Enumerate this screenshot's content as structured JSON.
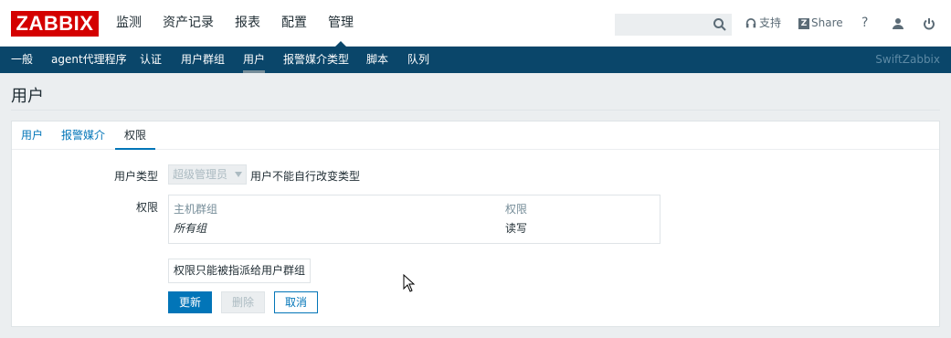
{
  "logo": "ZABBIX",
  "main_menu": [
    "监测",
    "资产记录",
    "报表",
    "配置",
    "管理"
  ],
  "main_menu_active": "管理",
  "search": {
    "placeholder": ""
  },
  "top_actions": {
    "support": "支持",
    "share": "Share",
    "help": "?"
  },
  "sub_menu": [
    "一般",
    "agent代理程序",
    "认证",
    "用户群组",
    "用户",
    "报警媒介类型",
    "脚本",
    "队列"
  ],
  "sub_menu_active": "用户",
  "brand": "SwiftZabbix",
  "page_title": "用户",
  "tabs": [
    "用户",
    "报警媒介",
    "权限"
  ],
  "tab_active": "权限",
  "form": {
    "user_type_label": "用户类型",
    "user_type_value": "超级管理员",
    "user_type_note": "用户不能自行改变类型",
    "permissions_label": "权限",
    "table_headers": [
      "主机群组",
      "权限"
    ],
    "table_rows": [
      {
        "group": "所有组",
        "permission": "读写"
      }
    ],
    "assign_note": "权限只能被指派给用户群组"
  },
  "buttons": {
    "update": "更新",
    "delete": "删除",
    "cancel": "取消"
  },
  "colors": {
    "brand_red": "#d40000",
    "nav_bg": "#0a466a",
    "accent": "#0275b8"
  },
  "icons": [
    "search-icon",
    "headset-icon",
    "share-icon",
    "help-icon",
    "user-icon",
    "power-icon",
    "cursor-icon"
  ]
}
